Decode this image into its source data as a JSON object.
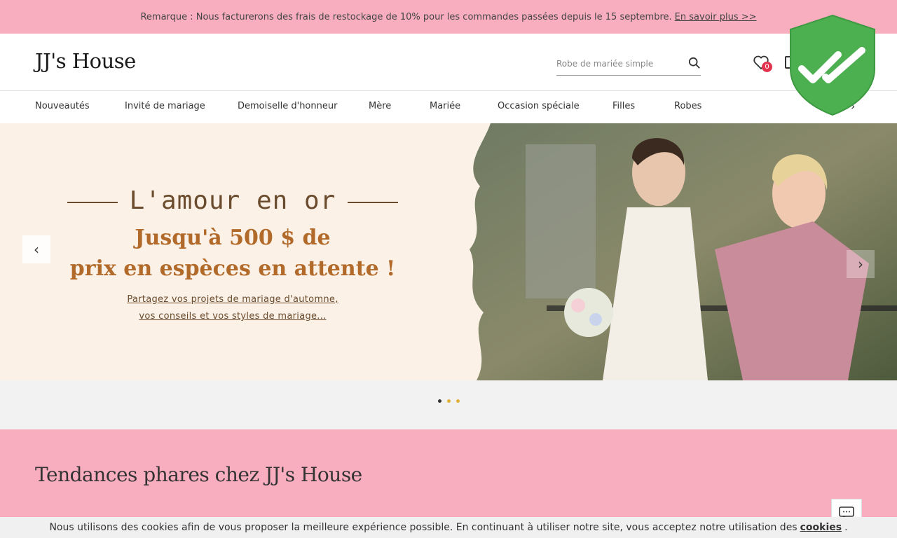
{
  "notice": {
    "text": "Remarque : Nous facturerons des frais de restockage de 10% pour les commandes passées depuis le 15 septembre.",
    "link": "En savoir plus >>"
  },
  "header": {
    "logo": "JJ's House",
    "search_placeholder": "Robe de mariée simple",
    "wishlist_count": "0"
  },
  "nav": {
    "items": [
      "Nouveautés",
      "Invité de mariage",
      "Demoiselle d'honneur",
      "Mère",
      "Mariée",
      "Occasion spéciale",
      "Filles",
      "Robes"
    ]
  },
  "hero": {
    "title": "L'amour en or",
    "subtitle_line1": "Jusqu'à 500 $ de",
    "subtitle_line2": "prix en espèces en attente !",
    "desc_line1": "Partagez vos projets de mariage d'automne,",
    "desc_line2": "vos conseils et vos styles de mariage..."
  },
  "carousel": {
    "dot_colors": [
      "#333333",
      "#e0b03a",
      "#e0b03a"
    ]
  },
  "trends": {
    "title": "Tendances phares chez JJ's House"
  },
  "cookie": {
    "text": "Nous utilisons des cookies afin de vous proposer la meilleure expérience possible. En continuant à utiliser notre site, vous acceptez notre utilisation des",
    "link": "cookies",
    "end": "."
  },
  "colors": {
    "pink": "#f8aebf",
    "shield_green": "#4caf50",
    "hero_bg": "#fbf1e6"
  }
}
